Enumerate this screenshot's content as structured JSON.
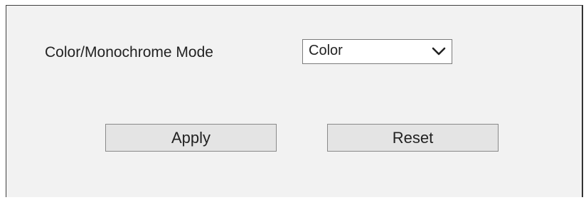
{
  "settings": {
    "mode_label": "Color/Monochrome Mode",
    "mode_select": {
      "selected": "Color",
      "icon": "chevron-down-icon"
    }
  },
  "actions": {
    "apply_label": "Apply",
    "reset_label": "Reset"
  }
}
